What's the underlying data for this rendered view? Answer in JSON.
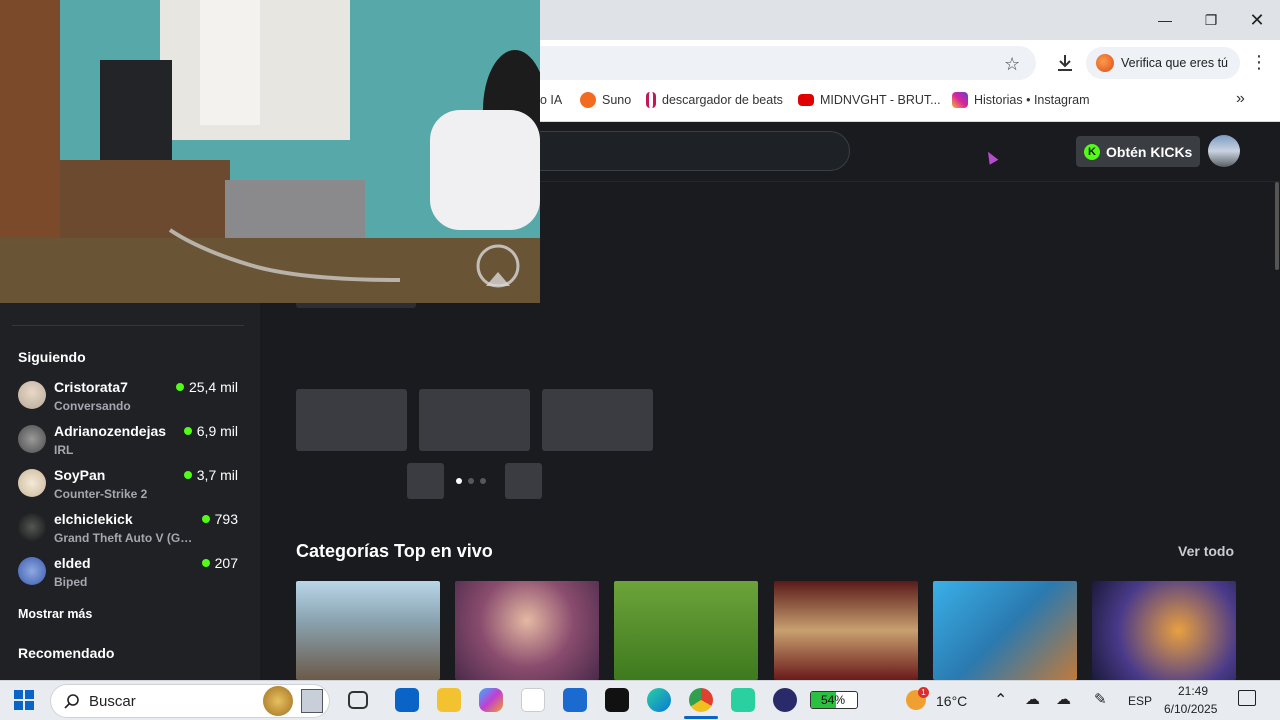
{
  "browser": {
    "verify_chip": "Verifica que eres tú",
    "bookmarks": [
      {
        "label": "o IA",
        "icon_color": "#ffffff"
      },
      {
        "label": "Suno",
        "icon_color": "#f26b21"
      },
      {
        "label": "descargador de beats",
        "icon_color": "#c2185b"
      },
      {
        "label": "MIDNVGHT - BRUT...",
        "icon_color": "#e00000"
      },
      {
        "label": "Historias • Instagram",
        "icon_color": "#d6249f"
      }
    ]
  },
  "header": {
    "kicks_label": "Obtén KICKs",
    "kicks_letter": "K"
  },
  "sidebar": {
    "following_title": "Siguiendo",
    "following": [
      {
        "name": "Cristorata7",
        "category": "Conversando",
        "viewers": "25,4 mil"
      },
      {
        "name": "Adrianozendejas",
        "category": "IRL",
        "viewers": "6,9 mil"
      },
      {
        "name": "SoyPan",
        "category": "Counter-Strike 2",
        "viewers": "3,7 mil"
      },
      {
        "name": "elchiclekick",
        "category": "Grand Theft Auto V (GTA V)",
        "viewers": "793"
      },
      {
        "name": "elded",
        "category": "Biped",
        "viewers": "207"
      }
    ],
    "show_more": "Mostrar más",
    "recommended_title": "Recomendado"
  },
  "main": {
    "categories_title": "Categorías Top en vivo",
    "see_all": "Ver todo",
    "carousel_pages": 3,
    "carousel_active": 1
  },
  "taskbar": {
    "search_placeholder": "Buscar",
    "battery": "54%",
    "weather": "16°C",
    "weather_badge": "1",
    "language": "ESP",
    "time": "21:49",
    "date": "6/10/2025"
  },
  "colors": {
    "accent": "#53fc18",
    "page_bg": "#191b1f",
    "sidebar_bg": "#1f2125"
  }
}
